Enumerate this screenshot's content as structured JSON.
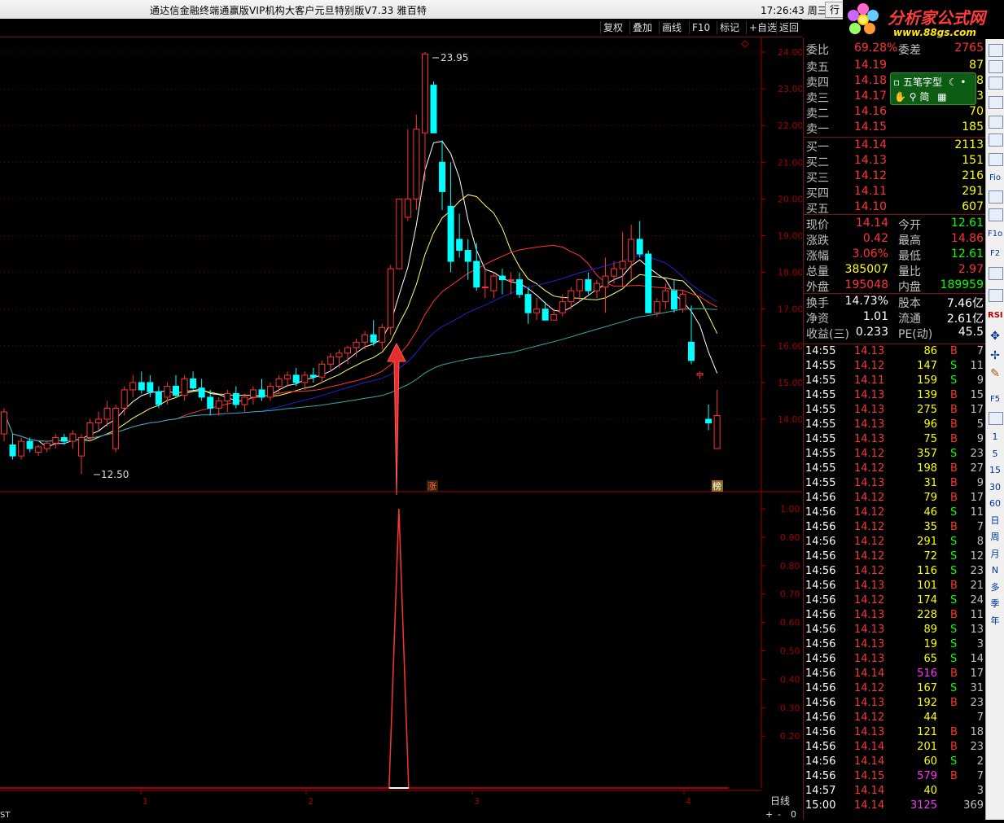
{
  "window": {
    "title": "通达信金融终端通赢版VIP机构大客户元旦特别版V7.33  雅百特",
    "time": "17:26:43 周三",
    "hang_btn": "行"
  },
  "logo": {
    "name": "分析家公式网",
    "url": "www.88gs.com"
  },
  "toolbar": {
    "items": [
      "复权",
      "叠加",
      "画线",
      "F10",
      "标记",
      "+自选",
      "返回"
    ]
  },
  "chart": {
    "price_axis": [
      "24.00",
      "23.00",
      "22.00",
      "21.00",
      "20.00",
      "19.00",
      "18.00",
      "17.00",
      "16.00",
      "15.00",
      "14.00"
    ],
    "indicator_axis": [
      "1.00",
      "0.90",
      "0.80",
      "0.70",
      "0.60",
      "0.50",
      "0.40",
      "0.30",
      "0.20"
    ],
    "high_label": "23.95",
    "low_label": "12.50",
    "zhang_label": "涨",
    "bang_label": "榜",
    "x_axis": [
      "1",
      "2",
      "3",
      "4"
    ],
    "period_label": "日线",
    "bottom_left": "ST",
    "bottom_right_controls": [
      "+",
      "-",
      "0"
    ]
  },
  "chart_data": {
    "type": "candlestick",
    "ylim": [
      12.5,
      24.2
    ],
    "candles": [
      [
        13.6,
        14.3,
        13.4,
        14.2
      ],
      [
        13.3,
        13.6,
        12.9,
        13.0
      ],
      [
        13.0,
        13.5,
        12.9,
        13.4
      ],
      [
        13.4,
        13.5,
        13.1,
        13.2
      ],
      [
        13.1,
        13.3,
        13.0,
        13.25
      ],
      [
        13.2,
        13.4,
        13.1,
        13.35
      ],
      [
        13.35,
        13.6,
        13.2,
        13.5
      ],
      [
        13.5,
        13.6,
        13.3,
        13.4
      ],
      [
        13.4,
        13.7,
        13.2,
        13.6
      ],
      [
        13.0,
        13.6,
        12.5,
        13.5
      ],
      [
        13.5,
        14.0,
        13.4,
        13.9
      ],
      [
        13.9,
        14.2,
        13.7,
        14.0
      ],
      [
        14.0,
        14.5,
        13.8,
        14.3
      ],
      [
        13.2,
        14.4,
        13.1,
        14.3
      ],
      [
        14.3,
        14.9,
        14.1,
        14.8
      ],
      [
        14.8,
        15.2,
        14.6,
        15.0
      ],
      [
        15.0,
        15.3,
        14.7,
        14.8
      ],
      [
        15.0,
        15.2,
        14.6,
        14.75
      ],
      [
        14.75,
        14.9,
        14.3,
        14.4
      ],
      [
        14.6,
        15.0,
        14.4,
        14.9
      ],
      [
        14.9,
        15.2,
        14.6,
        14.65
      ],
      [
        14.65,
        15.2,
        14.5,
        15.1
      ],
      [
        15.1,
        15.3,
        14.8,
        14.85
      ],
      [
        14.85,
        15.1,
        14.5,
        14.6
      ],
      [
        14.6,
        14.8,
        14.1,
        14.3
      ],
      [
        14.3,
        14.6,
        14.1,
        14.5
      ],
      [
        14.5,
        14.8,
        14.2,
        14.7
      ],
      [
        14.7,
        14.9,
        14.3,
        14.4
      ],
      [
        14.4,
        14.7,
        14.2,
        14.6
      ],
      [
        14.6,
        14.9,
        14.4,
        14.8
      ],
      [
        14.8,
        15.1,
        14.5,
        14.6
      ],
      [
        14.6,
        15.0,
        14.5,
        14.9
      ],
      [
        14.9,
        15.2,
        14.7,
        15.1
      ],
      [
        15.1,
        15.3,
        14.9,
        15.2
      ],
      [
        15.2,
        15.4,
        14.9,
        15.0
      ],
      [
        15.0,
        15.3,
        14.8,
        15.2
      ],
      [
        15.2,
        15.4,
        15.0,
        15.15
      ],
      [
        15.15,
        15.6,
        15.0,
        15.5
      ],
      [
        15.5,
        15.8,
        15.3,
        15.7
      ],
      [
        15.7,
        15.9,
        15.4,
        15.8
      ],
      [
        15.8,
        16.0,
        15.5,
        15.95
      ],
      [
        15.95,
        16.2,
        15.7,
        16.1
      ],
      [
        16.1,
        16.4,
        15.9,
        16.3
      ],
      [
        16.3,
        16.7,
        16.0,
        16.1
      ],
      [
        16.1,
        16.6,
        15.9,
        16.5
      ],
      [
        16.5,
        18.2,
        16.3,
        18.1
      ],
      [
        18.1,
        20.0,
        18.1,
        20.0
      ],
      [
        19.5,
        21.9,
        19.4,
        20.0
      ],
      [
        20.0,
        22.3,
        19.7,
        21.9
      ],
      [
        21.8,
        24.0,
        20.5,
        23.95
      ],
      [
        23.1,
        23.2,
        21.8,
        21.8
      ],
      [
        21.0,
        21.6,
        19.7,
        20.2
      ],
      [
        19.8,
        21.0,
        18.0,
        18.3
      ],
      [
        18.9,
        19.6,
        18.4,
        18.6
      ],
      [
        18.6,
        18.9,
        17.8,
        18.3
      ],
      [
        18.3,
        18.8,
        17.5,
        17.6
      ],
      [
        17.6,
        18.1,
        17.3,
        17.6
      ],
      [
        17.5,
        18.0,
        17.3,
        17.9
      ],
      [
        17.9,
        18.1,
        17.4,
        17.8
      ],
      [
        17.8,
        18.0,
        17.4,
        17.8
      ],
      [
        17.8,
        18.0,
        17.3,
        17.4
      ],
      [
        17.4,
        17.6,
        16.6,
        16.9
      ],
      [
        16.9,
        17.3,
        16.7,
        17.0
      ],
      [
        17.0,
        17.2,
        16.7,
        16.7
      ],
      [
        16.7,
        17.0,
        16.7,
        16.85
      ],
      [
        16.9,
        17.4,
        16.8,
        17.2
      ],
      [
        17.2,
        17.6,
        17.0,
        17.5
      ],
      [
        17.5,
        17.8,
        17.2,
        17.8
      ],
      [
        17.8,
        18.0,
        17.4,
        17.5
      ],
      [
        17.5,
        17.8,
        17.3,
        17.7
      ],
      [
        17.6,
        18.4,
        16.9,
        17.9
      ],
      [
        17.9,
        18.3,
        17.7,
        18.1
      ],
      [
        18.1,
        19.1,
        17.6,
        18.3
      ],
      [
        18.3,
        19.3,
        17.8,
        18.9
      ],
      [
        18.9,
        19.4,
        18.4,
        18.5
      ],
      [
        18.5,
        18.6,
        16.9,
        16.9
      ],
      [
        16.9,
        17.3,
        16.8,
        17.2
      ],
      [
        17.2,
        17.7,
        17.0,
        17.5
      ],
      [
        17.5,
        17.8,
        16.9,
        17.0
      ],
      [
        17.0,
        17.5,
        16.9,
        17.4
      ],
      [
        16.1,
        17.1,
        15.5,
        15.6
      ],
      [
        15.2,
        15.3,
        15.1,
        15.25
      ],
      [
        14.0,
        14.4,
        13.7,
        13.9
      ],
      [
        13.2,
        14.8,
        13.2,
        14.1
      ]
    ],
    "indicator": {
      "peak_index": 47,
      "max": 1.0
    }
  },
  "quote": {
    "weibi": {
      "label": "委比",
      "value": "69.28%",
      "label2": "委差",
      "value2": "2765"
    },
    "sell": [
      {
        "label": "卖五",
        "price": "14.19",
        "vol": "87"
      },
      {
        "label": "卖四",
        "price": "14.18",
        "vol": "8"
      },
      {
        "label": "卖三",
        "price": "14.17",
        "vol": "63"
      },
      {
        "label": "卖二",
        "price": "14.16",
        "vol": "70"
      },
      {
        "label": "卖一",
        "price": "14.15",
        "vol": "185"
      }
    ],
    "buy": [
      {
        "label": "买一",
        "price": "14.14",
        "vol": "2113"
      },
      {
        "label": "买二",
        "price": "14.13",
        "vol": "151"
      },
      {
        "label": "买三",
        "price": "14.12",
        "vol": "216"
      },
      {
        "label": "买四",
        "price": "14.11",
        "vol": "291"
      },
      {
        "label": "买五",
        "price": "14.10",
        "vol": "607"
      }
    ],
    "stats": [
      {
        "l1": "现价",
        "v1": "14.14",
        "l2": "今开",
        "v2": "12.61"
      },
      {
        "l1": "涨跌",
        "v1": "0.42",
        "l2": "最高",
        "v2": "14.86"
      },
      {
        "l1": "涨幅",
        "v1": "3.06%",
        "l2": "最低",
        "v2": "12.61"
      },
      {
        "l1": "总量",
        "v1": "385007",
        "l2": "量比",
        "v2": "2.97"
      },
      {
        "l1": "外盘",
        "v1": "195048",
        "l2": "内盘",
        "v2": "189959"
      }
    ],
    "stats2": [
      {
        "l1": "换手",
        "v1": "14.73%",
        "l2": "股本",
        "v2": "7.46亿"
      },
      {
        "l1": "净资",
        "v1": "1.01",
        "l2": "流通",
        "v2": "2.61亿"
      },
      {
        "l1": "收益(三)",
        "v1": "0.233",
        "l2": "PE(动)",
        "v2": "45.5"
      }
    ]
  },
  "ticks": [
    [
      "14:55",
      "14.13",
      "86",
      "B",
      "7"
    ],
    [
      "14:55",
      "14.12",
      "147",
      "S",
      "11"
    ],
    [
      "14:55",
      "14.11",
      "159",
      "S",
      "9"
    ],
    [
      "14:55",
      "14.13",
      "139",
      "B",
      "15"
    ],
    [
      "14:55",
      "14.13",
      "275",
      "B",
      "17"
    ],
    [
      "14:55",
      "14.13",
      "96",
      "B",
      "5"
    ],
    [
      "14:55",
      "14.13",
      "75",
      "B",
      "9"
    ],
    [
      "14:55",
      "14.12",
      "357",
      "S",
      "23"
    ],
    [
      "14:55",
      "14.12",
      "198",
      "B",
      "27"
    ],
    [
      "14:55",
      "14.13",
      "31",
      "B",
      "9"
    ],
    [
      "14:56",
      "14.12",
      "79",
      "B",
      "17"
    ],
    [
      "14:56",
      "14.12",
      "46",
      "S",
      "11"
    ],
    [
      "14:56",
      "14.12",
      "35",
      "B",
      "7"
    ],
    [
      "14:56",
      "14.12",
      "291",
      "S",
      "8"
    ],
    [
      "14:56",
      "14.12",
      "72",
      "S",
      "12"
    ],
    [
      "14:56",
      "14.12",
      "116",
      "S",
      "23"
    ],
    [
      "14:56",
      "14.13",
      "101",
      "B",
      "21"
    ],
    [
      "14:56",
      "14.12",
      "174",
      "S",
      "24"
    ],
    [
      "14:56",
      "14.13",
      "228",
      "B",
      "11"
    ],
    [
      "14:56",
      "14.13",
      "89",
      "S",
      "13"
    ],
    [
      "14:56",
      "14.13",
      "19",
      "S",
      "3"
    ],
    [
      "14:56",
      "14.13",
      "65",
      "S",
      "14"
    ],
    [
      "14:56",
      "14.14",
      "516",
      "B",
      "17"
    ],
    [
      "14:56",
      "14.12",
      "167",
      "S",
      "31"
    ],
    [
      "14:56",
      "14.13",
      "192",
      "B",
      "23"
    ],
    [
      "14:56",
      "14.12",
      "44",
      "",
      "7"
    ],
    [
      "14:56",
      "14.13",
      "121",
      "B",
      "18"
    ],
    [
      "14:56",
      "14.14",
      "201",
      "B",
      "23"
    ],
    [
      "14:56",
      "14.14",
      "60",
      "S",
      "2"
    ],
    [
      "14:56",
      "14.15",
      "579",
      "B",
      "7"
    ],
    [
      "14:57",
      "14.14",
      "40",
      "",
      "3"
    ],
    [
      "15:00",
      "14.14",
      "3125",
      "",
      "369"
    ]
  ],
  "popup": {
    "title": "五笔字型",
    "mode": "简"
  },
  "sidebar": [
    "1",
    "5",
    "15",
    "30",
    "60",
    "日",
    "周",
    "月",
    "N",
    "多",
    "季",
    "年"
  ],
  "sidebar_small": [
    "Fio",
    "F1o",
    "F2",
    "RSI",
    "F5"
  ],
  "colors": {
    "up": "#ff3232",
    "down": "#00ffff",
    "bg": "#000000",
    "axis": "#a00000"
  }
}
